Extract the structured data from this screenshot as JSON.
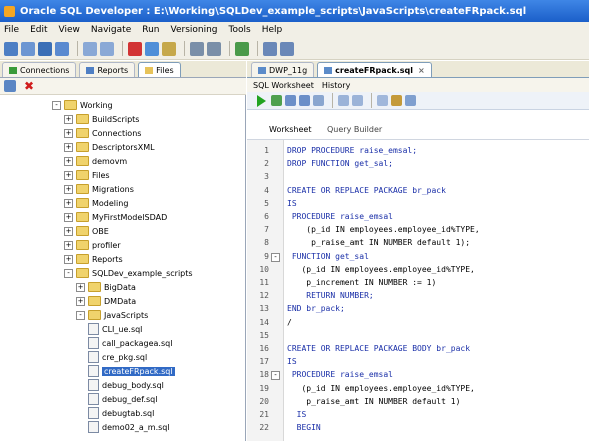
{
  "window": {
    "title": "Oracle SQL Developer : E:\\Working\\SQLDev_example_scripts\\JavaScripts\\createFRpack.sql"
  },
  "menu": [
    "File",
    "Edit",
    "View",
    "Navigate",
    "Run",
    "Versioning",
    "Tools",
    "Help"
  ],
  "nav_tabs": [
    "Connections",
    "Reports",
    "Files"
  ],
  "tree": [
    {
      "label": "Working",
      "depth": 0,
      "type": "folder",
      "exp": "-"
    },
    {
      "label": "BuildScripts",
      "depth": 1,
      "type": "folder",
      "exp": "+"
    },
    {
      "label": "Connections",
      "depth": 1,
      "type": "folder",
      "exp": "+"
    },
    {
      "label": "DescriptorsXML",
      "depth": 1,
      "type": "folder",
      "exp": "+"
    },
    {
      "label": "demovm",
      "depth": 1,
      "type": "folder",
      "exp": "+"
    },
    {
      "label": "Files",
      "depth": 1,
      "type": "folder",
      "exp": "+"
    },
    {
      "label": "Migrations",
      "depth": 1,
      "type": "folder",
      "exp": "+"
    },
    {
      "label": "Modeling",
      "depth": 1,
      "type": "folder",
      "exp": "+"
    },
    {
      "label": "MyFirstModelSDAD",
      "depth": 1,
      "type": "folder",
      "exp": "+"
    },
    {
      "label": "OBE",
      "depth": 1,
      "type": "folder",
      "exp": "+"
    },
    {
      "label": "profiler",
      "depth": 1,
      "type": "folder",
      "exp": "+"
    },
    {
      "label": "Reports",
      "depth": 1,
      "type": "folder",
      "exp": "+"
    },
    {
      "label": "SQLDev_example_scripts",
      "depth": 1,
      "type": "folder",
      "exp": "-"
    },
    {
      "label": "BigData",
      "depth": 2,
      "type": "folder",
      "exp": "+"
    },
    {
      "label": "DMData",
      "depth": 2,
      "type": "folder",
      "exp": "+"
    },
    {
      "label": "JavaScripts",
      "depth": 2,
      "type": "folder",
      "exp": "-"
    },
    {
      "label": "CLI_ue.sql",
      "depth": 3,
      "type": "file"
    },
    {
      "label": "call_packagea.sql",
      "depth": 3,
      "type": "file"
    },
    {
      "label": "cre_pkg.sql",
      "depth": 3,
      "type": "file"
    },
    {
      "label": "createFRpack.sql",
      "depth": 3,
      "type": "file",
      "selected": true
    },
    {
      "label": "debug_body.sql",
      "depth": 3,
      "type": "file"
    },
    {
      "label": "debug_def.sql",
      "depth": 3,
      "type": "file"
    },
    {
      "label": "debugtab.sql",
      "depth": 3,
      "type": "file"
    },
    {
      "label": "demo02_a_m.sql",
      "depth": 3,
      "type": "file"
    }
  ],
  "doc_tabs": [
    "DWP_11g",
    "createFRpack.sql"
  ],
  "sub_tabs": [
    "SQL Worksheet",
    "History"
  ],
  "worksheet_tabs": {
    "worksheet": "Worksheet",
    "query_builder": "Query Builder"
  },
  "code_lines": [
    {
      "n": "1",
      "text": "DROP PROCEDURE raise_emsal;",
      "fold": ""
    },
    {
      "n": "2",
      "text": "DROP FUNCTION get_sal;",
      "fold": ""
    },
    {
      "n": "3",
      "text": "",
      "fold": ""
    },
    {
      "n": "4",
      "text": "CREATE OR REPLACE PACKAGE br_pack",
      "fold": ""
    },
    {
      "n": "5",
      "text": "IS",
      "fold": ""
    },
    {
      "n": "6",
      "text": " PROCEDURE raise_emsal",
      "fold": ""
    },
    {
      "n": "7",
      "text": "    (p_id IN employees.employee_id%TYPE,",
      "fold": ""
    },
    {
      "n": "8",
      "text": "     p_raise_amt IN NUMBER default 1);",
      "fold": ""
    },
    {
      "n": "9",
      "text": " FUNCTION get_sal",
      "fold": "-"
    },
    {
      "n": "10",
      "text": "   (p_id IN employees.employee_id%TYPE,",
      "fold": ""
    },
    {
      "n": "11",
      "text": "    p_increment IN NUMBER := 1)",
      "fold": ""
    },
    {
      "n": "12",
      "text": "    RETURN NUMBER;",
      "fold": ""
    },
    {
      "n": "13",
      "text": "END br_pack;",
      "fold": ""
    },
    {
      "n": "14",
      "text": "/",
      "fold": ""
    },
    {
      "n": "15",
      "text": "",
      "fold": ""
    },
    {
      "n": "16",
      "text": "CREATE OR REPLACE PACKAGE BODY br_pack",
      "fold": ""
    },
    {
      "n": "17",
      "text": "IS",
      "fold": ""
    },
    {
      "n": "18",
      "text": " PROCEDURE raise_emsal",
      "fold": "-"
    },
    {
      "n": "19",
      "text": "   (p_id IN employees.employee_id%TYPE,",
      "fold": ""
    },
    {
      "n": "20",
      "text": "    p_raise_amt IN NUMBER default 1)",
      "fold": ""
    },
    {
      "n": "21",
      "text": "  IS",
      "fold": ""
    },
    {
      "n": "22",
      "text": "  BEGIN",
      "fold": ""
    }
  ]
}
